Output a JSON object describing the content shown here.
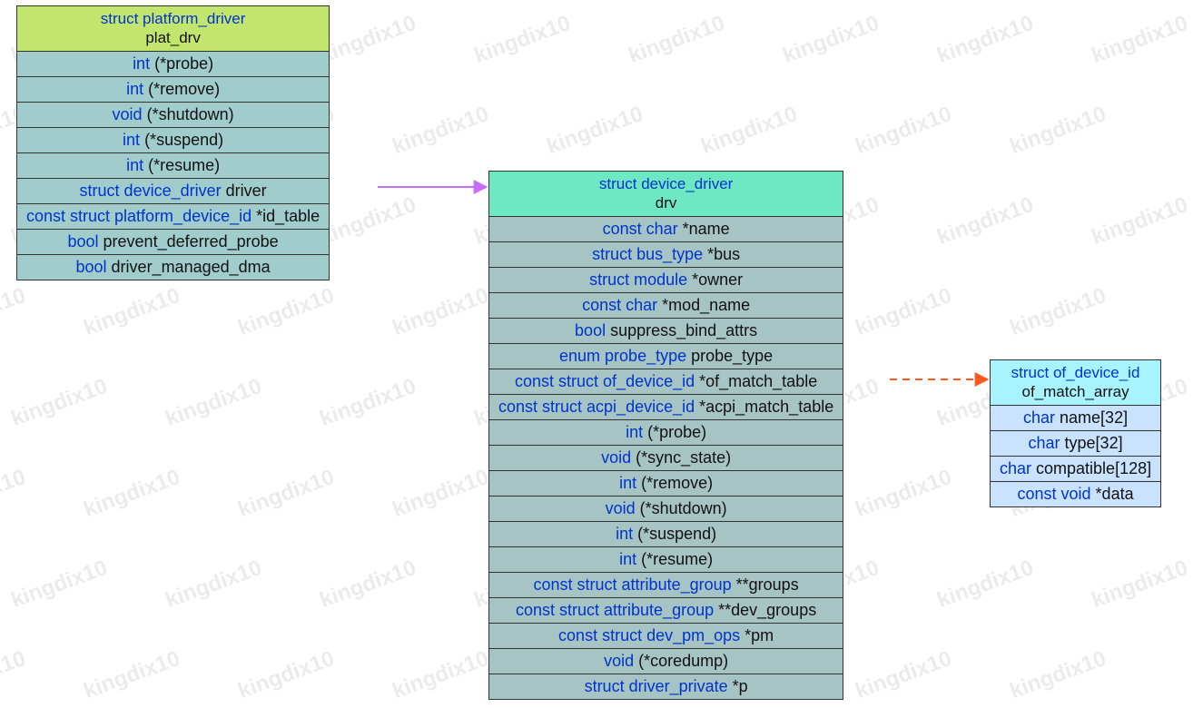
{
  "watermark_text": "kingdix10",
  "tables": {
    "plat": {
      "header_type": "struct platform_driver",
      "header_name": "plat_drv",
      "rows": [
        {
          "type": "int",
          "field": " (*probe)"
        },
        {
          "type": "int",
          "field": " (*remove)"
        },
        {
          "type": "void",
          "field": " (*shutdown)"
        },
        {
          "type": "int",
          "field": " (*suspend)"
        },
        {
          "type": "int",
          "field": " (*resume)"
        },
        {
          "type": "struct device_driver",
          "field": " driver"
        },
        {
          "type": "const struct platform_device_id",
          "field": " *id_table"
        },
        {
          "type": "bool",
          "field": " prevent_deferred_probe"
        },
        {
          "type": "bool",
          "field": " driver_managed_dma"
        }
      ]
    },
    "drv": {
      "header_type": "struct device_driver",
      "header_name": "drv",
      "rows": [
        {
          "type": "const char",
          "field": " *name"
        },
        {
          "type": "struct bus_type",
          "field": " *bus"
        },
        {
          "type": "struct module",
          "field": " *owner"
        },
        {
          "type": "const char",
          "field": " *mod_name"
        },
        {
          "type": "bool",
          "field": " suppress_bind_attrs"
        },
        {
          "type": "enum probe_type",
          "field": " probe_type"
        },
        {
          "type": "const struct of_device_id",
          "field": " *of_match_table"
        },
        {
          "type": "const struct acpi_device_id",
          "field": " *acpi_match_table"
        },
        {
          "type": "int",
          "field": " (*probe)"
        },
        {
          "type": "void",
          "field": " (*sync_state)"
        },
        {
          "type": "int",
          "field": " (*remove)"
        },
        {
          "type": "void",
          "field": " (*shutdown)"
        },
        {
          "type": "int",
          "field": " (*suspend)"
        },
        {
          "type": "int",
          "field": " (*resume)"
        },
        {
          "type": "const struct attribute_group",
          "field": " **groups"
        },
        {
          "type": "const struct attribute_group",
          "field": " **dev_groups"
        },
        {
          "type": "const struct dev_pm_ops",
          "field": " *pm"
        },
        {
          "type": "void",
          "field": " (*coredump)"
        },
        {
          "type": "struct driver_private",
          "field": " *p"
        }
      ]
    },
    "ofm": {
      "header_type": "struct of_device_id",
      "header_name": "of_match_array",
      "rows": [
        {
          "type": "char",
          "field": " name[32]"
        },
        {
          "type": "char",
          "field": " type[32]"
        },
        {
          "type": "char",
          "field": " compatible[128]"
        },
        {
          "type": "const void",
          "field": " *data"
        }
      ]
    }
  },
  "colors": {
    "plat_header": "#c2e56e",
    "plat_row": "#a0cccc",
    "drv_header": "#6ee7c3",
    "drv_row": "#a7c4c4",
    "ofm_header": "#a7f3ff",
    "ofm_row": "#c8e2ff",
    "arrow_solid": "#c86cff",
    "arrow_dashed": "#ff5a1f"
  }
}
